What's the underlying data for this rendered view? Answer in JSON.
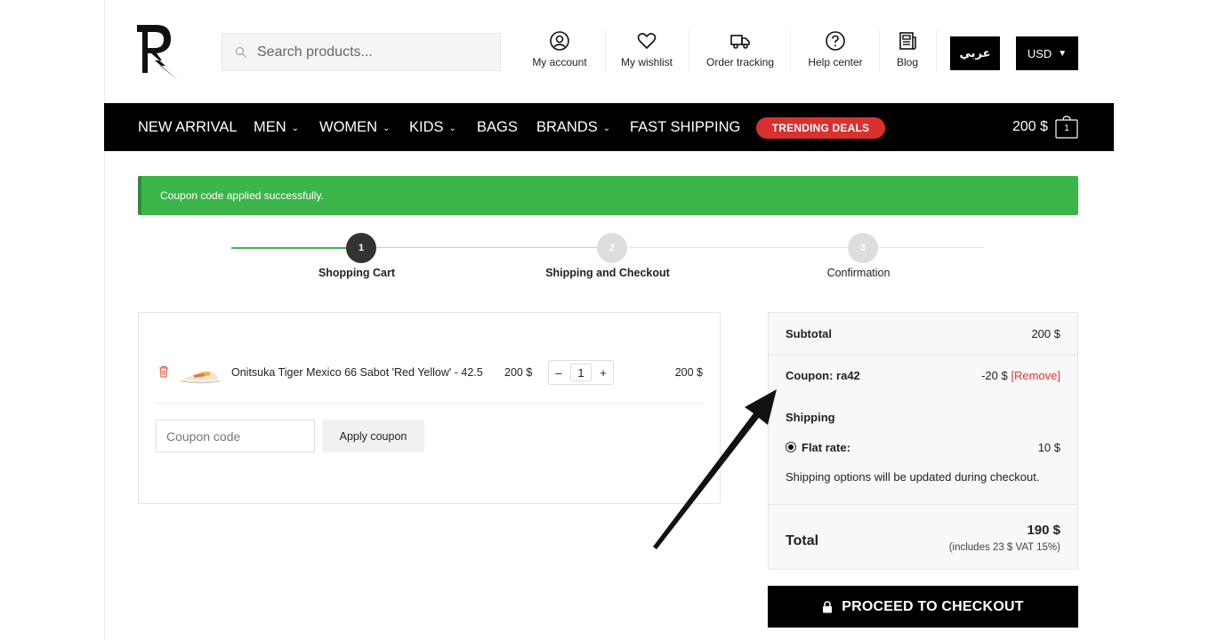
{
  "header": {
    "search_placeholder": "Search products...",
    "nav_links": [
      {
        "label": "My account",
        "icon": "account-icon"
      },
      {
        "label": "My wishlist",
        "icon": "heart-icon"
      },
      {
        "label": "Order tracking",
        "icon": "truck-icon"
      },
      {
        "label": "Help center",
        "icon": "help-icon"
      },
      {
        "label": "Blog",
        "icon": "newspaper-icon"
      }
    ],
    "language_button": "عربي",
    "currency_button": "USD"
  },
  "menu": {
    "items": [
      "NEW ARRIVAL",
      "MEN",
      "WOMEN",
      "KIDS",
      "BAGS",
      "BRANDS",
      "FAST SHIPPING"
    ],
    "trending": "TRENDING DEALS",
    "cart_total": "200 $",
    "cart_count": "1"
  },
  "notice": "Coupon code applied successfully.",
  "steps": [
    {
      "number": "1",
      "label": "Shopping Cart",
      "state": "active"
    },
    {
      "number": "2",
      "label": "Shipping and Checkout",
      "state": "pending"
    },
    {
      "number": "3",
      "label": "Confirmation",
      "state": "pending"
    }
  ],
  "cart": {
    "item": {
      "name": "Onitsuka Tiger Mexico 66 Sabot 'Red Yellow' - 42.5",
      "price": "200 $",
      "qty_minus": "–",
      "qty": "1",
      "qty_plus": "+",
      "subtotal": "200 $"
    },
    "coupon_placeholder": "Coupon code",
    "apply_label": "Apply coupon"
  },
  "totals": {
    "subtotal_label": "Subtotal",
    "subtotal_value": "200 $",
    "coupon_label": "Coupon: ra42",
    "coupon_value": "-20 $",
    "coupon_remove": "[Remove]",
    "shipping_label": "Shipping",
    "flat_rate_label": "Flat rate:",
    "flat_rate_value": "10 $",
    "shipping_note": "Shipping options will be updated during checkout.",
    "total_label": "Total",
    "total_value": "190 $",
    "total_note": "(includes 23 $ VAT 15%)"
  },
  "checkout_label": "PROCEED TO CHECKOUT",
  "colors": {
    "notice_green": "#3cb54a",
    "step_active": "#333333",
    "step_pending": "#dddddd",
    "trending_red": "#d93030",
    "remove_red": "#ee3333"
  }
}
